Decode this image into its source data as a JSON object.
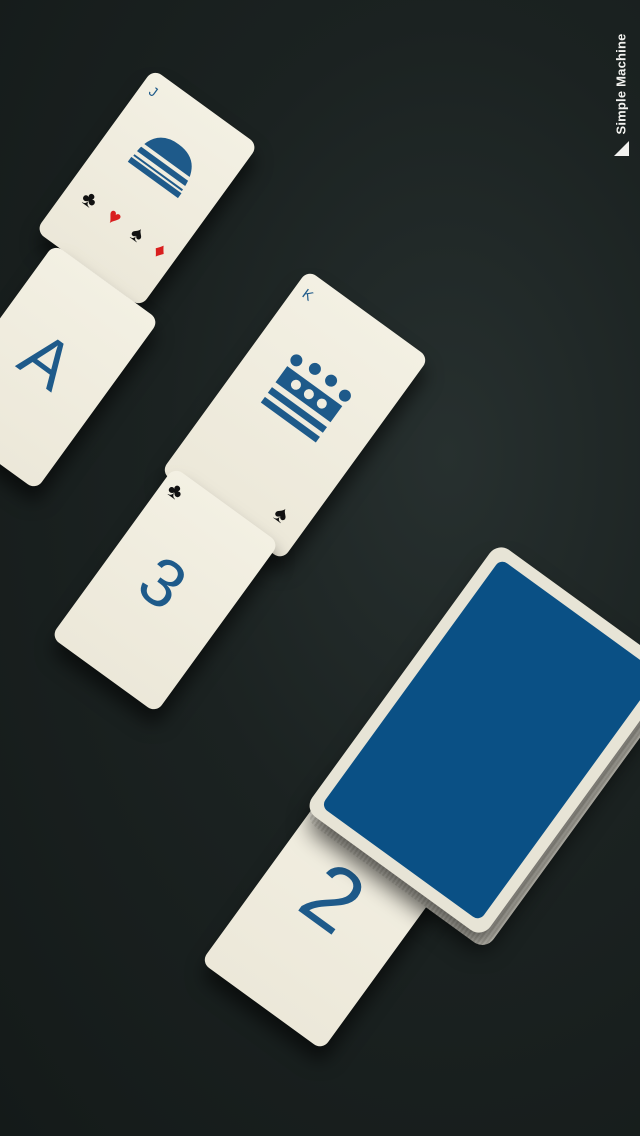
{
  "brand": {
    "name": "Simple Machine",
    "mark_icon": "triangle-logo-icon"
  },
  "colors": {
    "table": "#1b2221",
    "card": "#f0eddf",
    "rank": "#1e5a8a",
    "deck_back": "#0a5085",
    "red_suit": "#d91e1e"
  },
  "cards": [
    {
      "id": "jack",
      "corner": "J",
      "suits": [
        "♣",
        "♥",
        "♠",
        "♦"
      ]
    },
    {
      "id": "ace",
      "rank": "A"
    },
    {
      "id": "king",
      "corner": "K",
      "suit": "♠"
    },
    {
      "id": "three",
      "rank": "3",
      "suit": "♣"
    },
    {
      "id": "two",
      "rank": "2",
      "suit": "♠"
    }
  ],
  "deck": {
    "label": ""
  }
}
